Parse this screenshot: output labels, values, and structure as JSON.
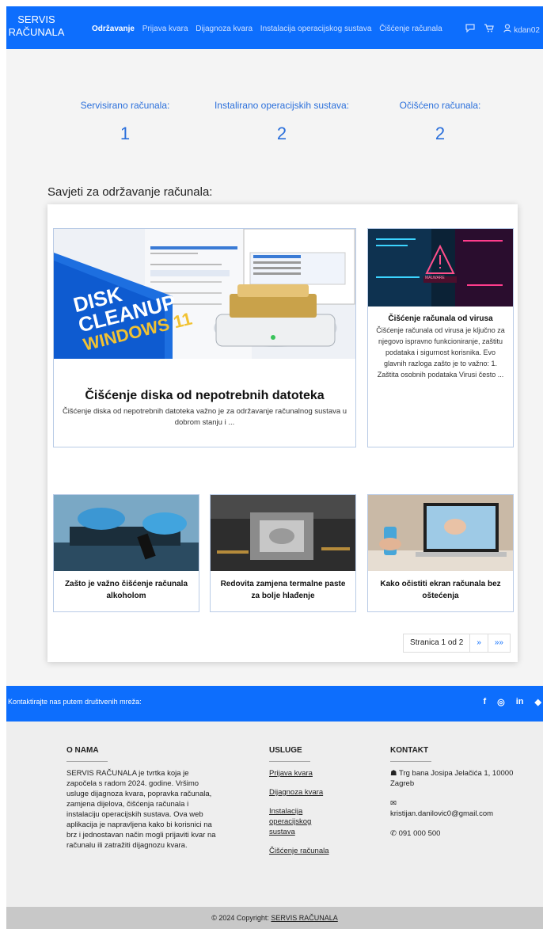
{
  "nav": {
    "brand_line1": "SERVIS",
    "brand_line2": "RAČUNALA",
    "links": [
      "Održavanje",
      "Prijava kvara",
      "Dijagnoza kvara",
      "Instalacija operacijskog sustava",
      "Čišćenje računala"
    ],
    "active_index": 0,
    "user": "kdan02",
    "icons": [
      "message-icon",
      "cart-icon",
      "user-icon"
    ]
  },
  "stats": [
    {
      "label": "Servisirano računala:",
      "value": "1"
    },
    {
      "label": "Instalirano operacijskih sustava:",
      "value": "2"
    },
    {
      "label": "Očišćeno računala:",
      "value": "2"
    }
  ],
  "tips": {
    "title": "Savjeti za održavanje računala:",
    "featured": {
      "title": "Čišćenje diska od nepotrebnih datoteka",
      "excerpt": "Čišćenje diska od nepotrebnih datoteka važno je za održavanje računalnog sustava u dobrom stanju i ...",
      "image_text_1": "DISK",
      "image_text_2": "CLEANUP",
      "image_text_3": "WINDOWS 11",
      "image_window_title": "System › Storage › Local",
      "image_window_sub": "Storage usage"
    },
    "side": {
      "title": "Čišćenje računala od virusa",
      "excerpt": "Čišćenje računala od virusa je ključno za njegovo ispravno funkcioniranje, zaštitu podataka i sigurnost korisnika. Evo glavnih razloga zašto je to važno: 1. Zaštita osobnih podataka Virusi često ...",
      "image_text": "MALWARE"
    },
    "small": [
      {
        "title": "Zašto je važno čišćenje računala alkoholom"
      },
      {
        "title": "Redovita zamjena termalne paste za bolje hlađenje"
      },
      {
        "title": "Kako očistiti ekran računala bez oštećenja"
      }
    ],
    "pager": {
      "label": "Stranica 1 od 2",
      "next": "»",
      "last": "»»"
    }
  },
  "social": {
    "text": "Kontaktirajte nas putem društvenih mreža:",
    "icons": [
      "facebook-icon",
      "instagram-icon",
      "linkedin-icon",
      "gitlab-icon"
    ],
    "glyphs": [
      "f",
      "◎",
      "in",
      "◆"
    ]
  },
  "footer": {
    "about_title": "O NAMA",
    "about_text": "SERVIS RAČUNALA je tvrtka koja je započela s radom 2024. godine. Vršimo usluge dijagnoza kvara, popravka računala, zamjena dijelova, čišćenja računala i instalaciju operacijskih sustava. Ova web aplikacija je napravljena kako bi korisnici na brz i jednostavan način mogli prijaviti kvar na računalu ili zatražiti dijagnozu kvara.",
    "services_title": "USLUGE",
    "services": [
      "Prijava kvara",
      "Dijagnoza kvara",
      "Instalacija operacijskog sustava",
      "Čišćenje računala"
    ],
    "contact_title": "KONTAKT",
    "address": "Trg bana Josipa Jelačića 1, 10000 Zagreb",
    "email": "kristijan.danilovic0@gmail.com",
    "phone": "091 000 500"
  },
  "copyright": {
    "text": "© 2024 Copyright: ",
    "link": "SERVIS RAČUNALA"
  },
  "colors": {
    "primary": "#0d6efd",
    "stat_text": "#2a6fdb",
    "footer_bg": "#eeeeee",
    "copyright_bg": "#c8c8c8"
  }
}
